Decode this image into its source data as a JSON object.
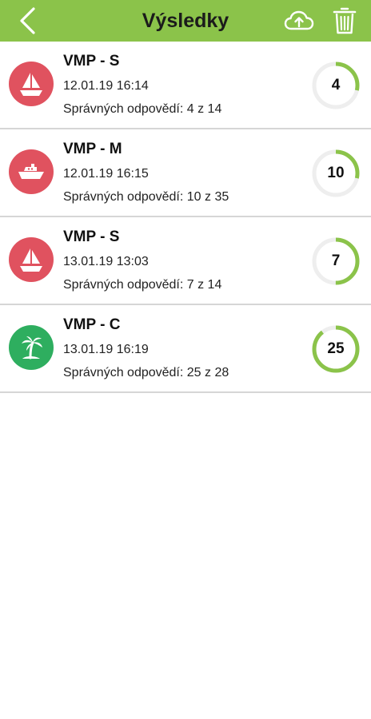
{
  "header": {
    "title": "Výsledky",
    "back_icon": "chevron-left-icon",
    "upload_icon": "cloud-upload-icon",
    "delete_icon": "trash-icon",
    "background_color": "#8bc34a"
  },
  "colors": {
    "accent": "#8bc34a",
    "red_avatar": "#e0525f",
    "green_avatar": "#2eae5f",
    "ring_track": "#eeeeee",
    "ring_progress": "#8bc34a",
    "divider": "#d6d6d6"
  },
  "results": [
    {
      "title": "VMP - S",
      "date": "12.01.19 16:14",
      "correct_text": "Správných odpovědí: 4 z 14",
      "score": "4",
      "correct": 4,
      "total": 14,
      "icon": "sailboat-icon",
      "avatar_color": "#e0525f"
    },
    {
      "title": "VMP - M",
      "date": "12.01.19 16:15",
      "correct_text": "Správných odpovědí: 10 z 35",
      "score": "10",
      "correct": 10,
      "total": 35,
      "icon": "motorboat-icon",
      "avatar_color": "#e0525f"
    },
    {
      "title": "VMP - S",
      "date": "13.01.19 13:03",
      "correct_text": "Správných odpovědí: 7 z 14",
      "score": "7",
      "correct": 7,
      "total": 14,
      "icon": "sailboat-icon",
      "avatar_color": "#e0525f"
    },
    {
      "title": "VMP - C",
      "date": "13.01.19 16:19",
      "correct_text": "Správných odpovědí: 25 z 28",
      "score": "25",
      "correct": 25,
      "total": 28,
      "icon": "palm-island-icon",
      "avatar_color": "#2eae5f"
    }
  ]
}
